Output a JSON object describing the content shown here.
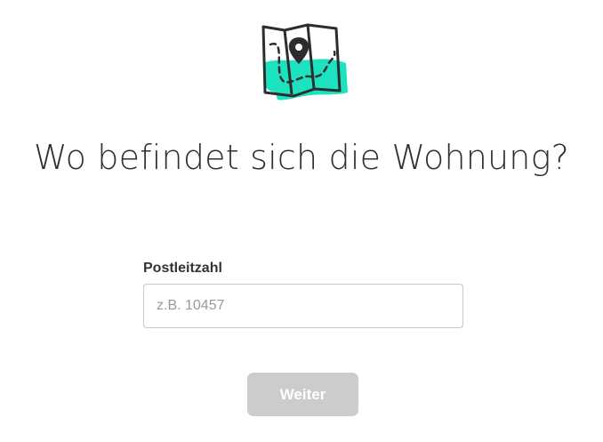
{
  "illustration": {
    "icon": "map-pin-icon",
    "accent_color": "#1de2bf",
    "line_color": "#2d2d2d"
  },
  "heading": "Wo befindet sich die Wohnung?",
  "postcode": {
    "label": "Postleitzahl",
    "placeholder": "z.B. 10457",
    "value": ""
  },
  "submit": {
    "label": "Weiter",
    "state": "disabled",
    "background": "#cccccc"
  }
}
